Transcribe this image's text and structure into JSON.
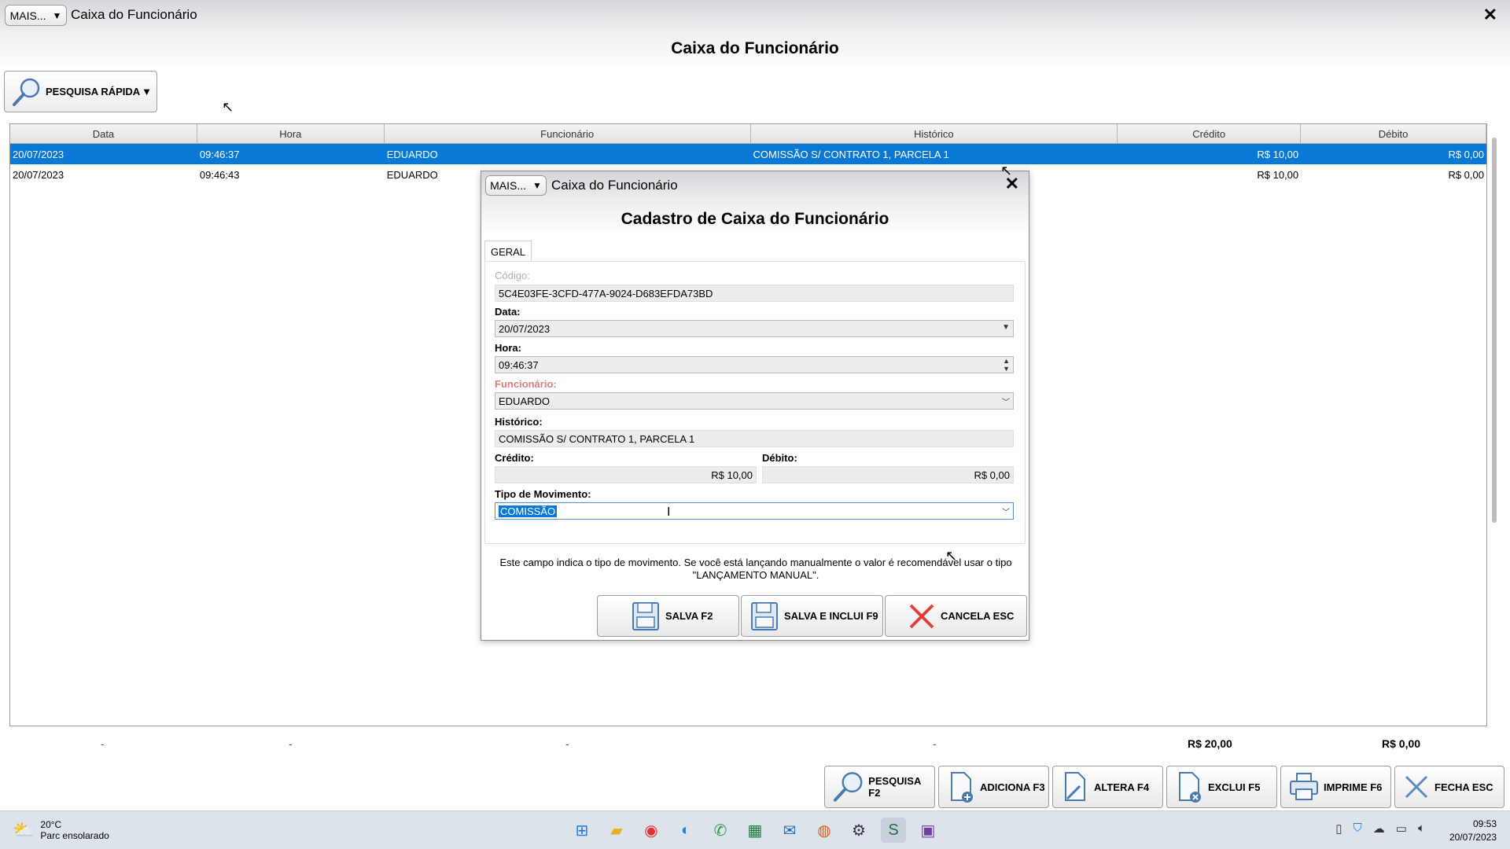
{
  "window": {
    "mais_label": "MAIS...",
    "title": "Caixa do Funcionário",
    "close_glyph": "✕",
    "page_title": "Caixa do Funcionário"
  },
  "quick_search": {
    "label": "PESQUISA RÁPIDA",
    "icon": "magnifier-icon"
  },
  "grid": {
    "columns": [
      "Data",
      "Hora",
      "Funcionário",
      "Histórico",
      "Crédito",
      "Débito"
    ],
    "rows": [
      {
        "data": "20/07/2023",
        "hora": "09:46:37",
        "funcionario": "EDUARDO",
        "historico": "COMISSÃO S/ CONTRATO 1, PARCELA 1",
        "credito": "R$ 10,00",
        "debito": "R$ 0,00",
        "selected": true
      },
      {
        "data": "20/07/2023",
        "hora": "09:46:43",
        "funcionario": "EDUARDO",
        "historico": "",
        "credito": "R$ 10,00",
        "debito": "R$ 0,00",
        "selected": false
      }
    ],
    "totals": {
      "dash": "-",
      "credito": "R$ 20,00",
      "debito": "R$ 0,00"
    }
  },
  "toolbar": {
    "pesquisa": "PESQUISA F2",
    "adiciona": "ADICIONA F3",
    "altera": "ALTERA F4",
    "exclui": "EXCLUI F5",
    "imprime": "IMPRIME F6",
    "fecha": "FECHA ESC"
  },
  "dialog": {
    "mais_label": "MAIS...",
    "title": "Caixa do Funcionário",
    "close_glyph": "✕",
    "heading": "Cadastro de Caixa do Funcionário",
    "tab": "GERAL",
    "codigo_label": "Código:",
    "codigo_value": "5C4E03FE-3CFD-477A-9024-D683EFDA73BD",
    "data_label": "Data:",
    "data_value": "20/07/2023",
    "hora_label": "Hora:",
    "hora_value": "09:46:37",
    "funcionario_label": "Funcionário:",
    "funcionario_value": "EDUARDO",
    "historico_label": "Histórico:",
    "historico_value": "COMISSÃO S/ CONTRATO 1, PARCELA 1",
    "credito_label": "Crédito:",
    "credito_value": "R$ 10,00",
    "debito_label": "Débito:",
    "debito_value": "R$ 0,00",
    "tipo_label": "Tipo de Movimento:",
    "tipo_value": "COMISSÃO",
    "hint_line1": "Este campo indica o tipo de movimento. Se você está lançando manualmente o valor é recomendável usar o tipo",
    "hint_line2": "\"LANÇAMENTO MANUAL\".",
    "btn_salva": "SALVA F2",
    "btn_salva_inclui": "SALVA E INCLUI F9",
    "btn_cancela": "CANCELA ESC"
  },
  "taskbar": {
    "temp": "20°C",
    "weather": "Parc ensolarado",
    "time": "09:53",
    "date": "20/07/2023"
  },
  "colors": {
    "selection": "#0a78d7",
    "required_label": "#d88078",
    "cancel_red": "#e0413a"
  }
}
